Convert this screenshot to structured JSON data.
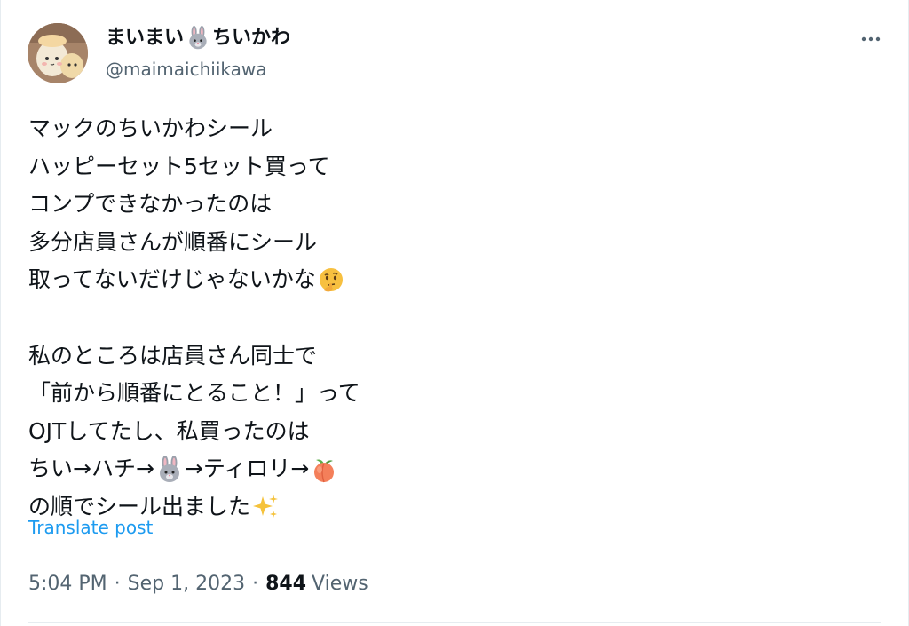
{
  "author": {
    "display_name_part1": "まいまい",
    "display_name_part2": "ちいかわ",
    "name_emoji": "rabbit-face-icon",
    "handle": "@maimaichiikawa"
  },
  "tweet": {
    "lines": [
      {
        "text": "マックのちいかわシール"
      },
      {
        "text": "ハッピーセット5セット買って"
      },
      {
        "text": "コンプできなかったのは"
      },
      {
        "text": "多分店員さんが順番にシール"
      },
      {
        "text": "取ってないだけじゃないかな",
        "emoji_after": "thinking-face-icon"
      },
      {
        "text": ""
      },
      {
        "text": "私のところは店員さん同士で"
      },
      {
        "text": "「前から順番にとること！」って"
      },
      {
        "text": "OJTしてたし、私買ったのは"
      },
      {
        "text": "ちい→ハチ→",
        "emoji_mid": "rabbit-face-icon",
        "text2": "→ティロリ→",
        "emoji_after": "peach-icon"
      },
      {
        "text": "の順でシール出ました",
        "emoji_after": "sparkles-icon"
      }
    ]
  },
  "translate_label": "Translate post",
  "meta": {
    "time": "5:04 PM",
    "date": "Sep 1, 2023",
    "separator": "·",
    "views_count": "844",
    "views_label": "Views"
  },
  "colors": {
    "text": "#0f1419",
    "secondary": "#536471",
    "link": "#1d9bf0",
    "divider": "#e6ecf0"
  }
}
